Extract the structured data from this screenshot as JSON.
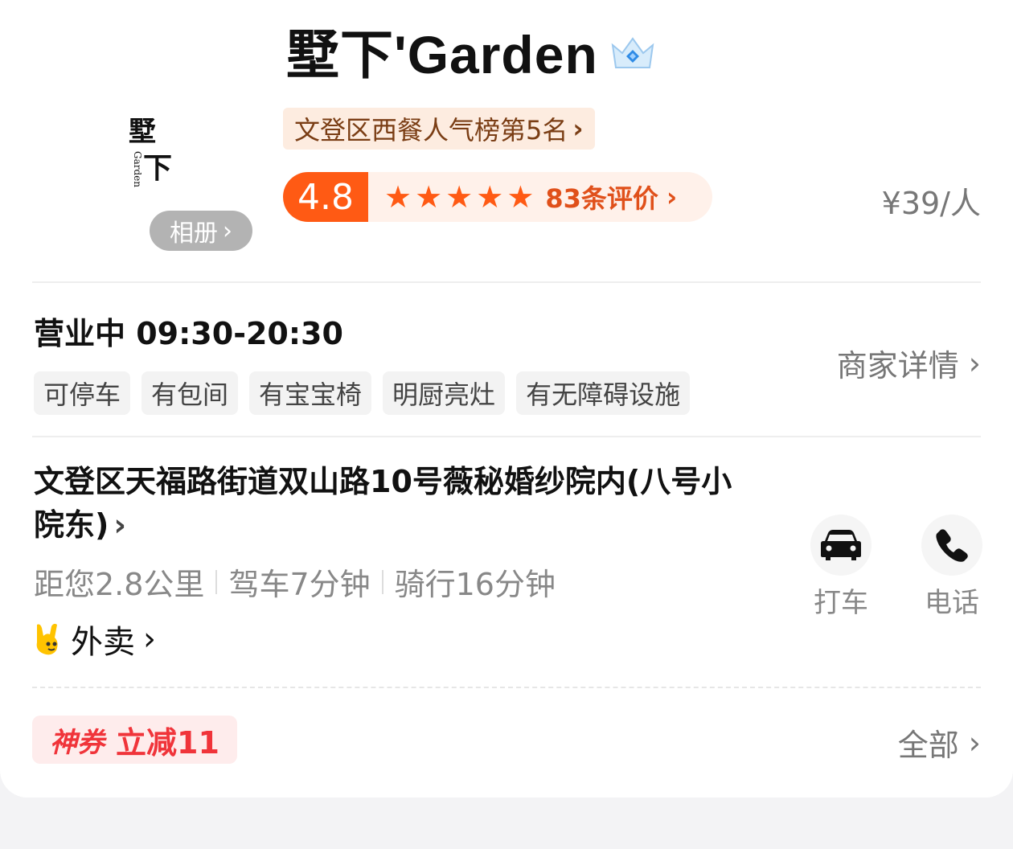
{
  "store": {
    "name": "墅下'Garden",
    "logo_text_main_1": "墅",
    "logo_text_main_2": "下",
    "logo_text_small": "Garden",
    "album_label": "相册",
    "rank_label": "文登区西餐人气榜第5名",
    "rating": "4.8",
    "star_count": 5,
    "reviews_label": "83条评价",
    "price_label": "¥39/人"
  },
  "hours": {
    "status_label": "营业中 09:30-20:30",
    "detail_link": "商家详情"
  },
  "tags": [
    "可停车",
    "有包间",
    "有宝宝椅",
    "明厨亮灶",
    "有无障碍设施"
  ],
  "address": {
    "text": "文登区天福路街道双山路10号薇秘婚纱院内(八号小院东)",
    "distance": "距您2.8公里",
    "drive": "驾车7分钟",
    "ride": "骑行16分钟",
    "delivery_label": "外卖"
  },
  "actions": {
    "taxi_label": "打车",
    "phone_label": "电话"
  },
  "coupon": {
    "badge": "神券",
    "text": "立减11",
    "all_label": "全部"
  },
  "colors": {
    "accent": "#ff5a14",
    "coupon": "#f0343a",
    "rank_text": "#7a3d14"
  },
  "icons": [
    "crown-icon",
    "star-icon",
    "chevron-right-icon",
    "car-icon",
    "phone-icon",
    "delivery-mascot-icon"
  ]
}
